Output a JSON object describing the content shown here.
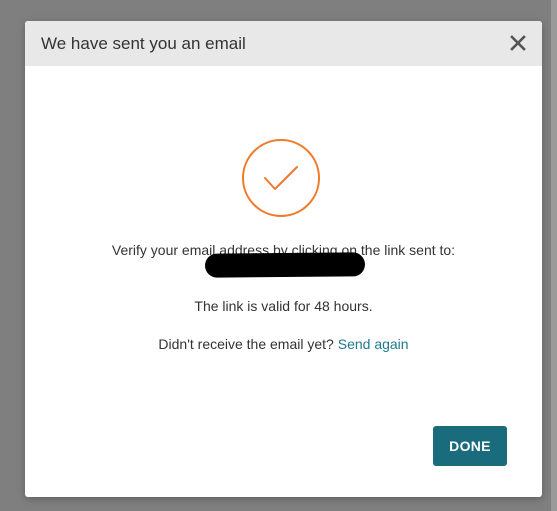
{
  "dialog": {
    "title": "We have sent you an email",
    "close_icon": "close-icon",
    "success_icon": "checkmark-circle-icon",
    "accent_color": "#f07a2a",
    "verify_message": "Verify your email address by clicking on the link sent to:",
    "email_redacted": true,
    "validity_message": "The link is valid for 48 hours.",
    "resend_prompt": "Didn't receive the email yet?",
    "resend_link_label": "Send again",
    "done_button_label": "DONE",
    "button_color": "#1a6c7d",
    "link_color": "#1f7a8c"
  }
}
